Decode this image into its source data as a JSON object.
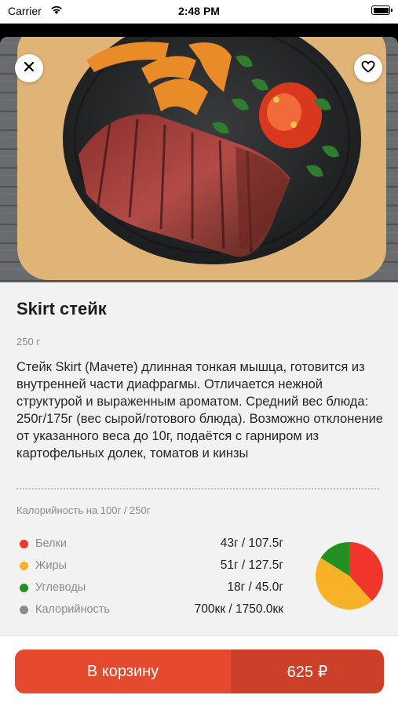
{
  "status_bar": {
    "carrier": "Carrier",
    "time": "2:48 PM"
  },
  "product": {
    "title": "Skirt стейк",
    "weight": "250 г",
    "description": "Стейк Skirt (Мачете) длинная тонкая мышца, готовится из внутренней части диафрагмы. Отличается нежной структурой  и выраженным ароматом. Средний вес блюда: 250г/175г (вес сырой/готового блюда). Возможно отклонение от указанного веса до 10г, подаётся с гарниром из картофельных долек, томатов и кинзы"
  },
  "nutrition": {
    "caption": "Калорийность на 100г / 250г",
    "rows": [
      {
        "label": "Белки",
        "value": "43г / 107.5г",
        "color": "#f2352b"
      },
      {
        "label": "Жиры",
        "value": "51г / 127.5г",
        "color": "#f8b227"
      },
      {
        "label": "Углеводы",
        "value": "18г / 45.0г",
        "color": "#239022"
      },
      {
        "label": "Калорийность",
        "value": "700кк / 1750.0кк",
        "color": "#8a8a8a"
      }
    ]
  },
  "chart_data": {
    "type": "pie",
    "labels": [
      "Белки",
      "Жиры",
      "Углеводы"
    ],
    "values": [
      43,
      51,
      18
    ],
    "colors": [
      "#f2352b",
      "#f8b227",
      "#239022"
    ]
  },
  "cart": {
    "button_label": "В корзину",
    "price": "625 ₽"
  },
  "icons": {
    "close": "close-icon",
    "favorite": "heart-icon",
    "wifi": "wifi-icon",
    "battery": "battery-icon"
  }
}
